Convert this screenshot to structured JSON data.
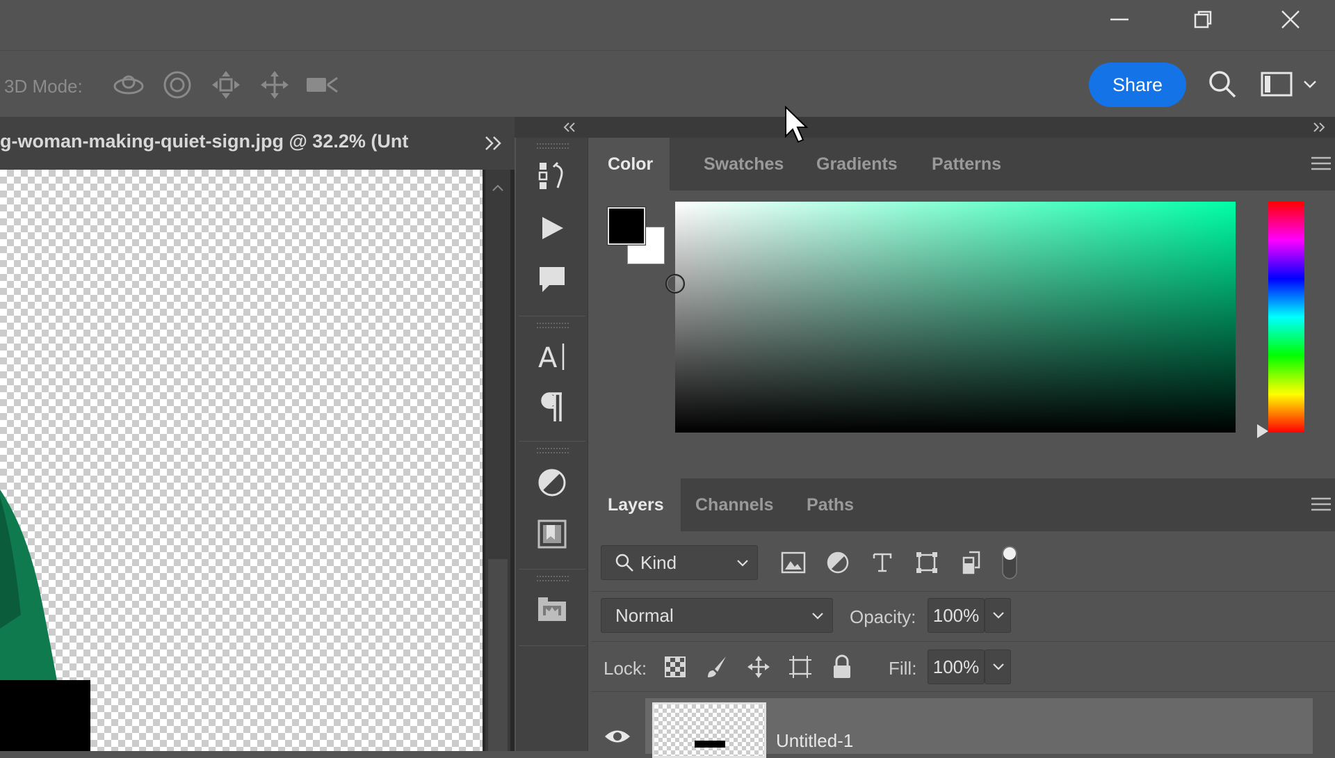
{
  "window": {
    "controls": [
      "minimize-icon",
      "restore-icon",
      "close-icon"
    ]
  },
  "options_bar": {
    "mode_label": "3D Mode:",
    "tools": [
      "orbit-3d-icon",
      "roll-3d-icon",
      "drag-3d-icon",
      "slide-3d-icon",
      "camera-zoom-icon"
    ],
    "share_label": "Share",
    "right_icons": [
      "search-icon",
      "workspace-icon",
      "chevron-down-icon"
    ]
  },
  "document": {
    "tab_title": "g-woman-making-quiet-sign.jpg @ 32.2% (Unt"
  },
  "icon_strip": [
    "history-icon",
    "actions-play-icon",
    "comments-icon",
    "character-icon",
    "paragraph-icon",
    "adjustments-icon",
    "libraries-icon",
    "properties-folder-icon"
  ],
  "color_panel": {
    "tabs": [
      {
        "label": "Color",
        "active": true
      },
      {
        "label": "Swatches",
        "active": false
      },
      {
        "label": "Gradients",
        "active": false
      },
      {
        "label": "Patterns",
        "active": false
      }
    ],
    "foreground": "#000000",
    "background": "#ffffff",
    "hue_color": "#00ffa6"
  },
  "layers_panel": {
    "tabs": [
      {
        "label": "Layers",
        "active": true
      },
      {
        "label": "Channels",
        "active": false
      },
      {
        "label": "Paths",
        "active": false
      }
    ],
    "filter_kind": "Kind",
    "filter_icons": [
      "image-filter-icon",
      "adjustment-filter-icon",
      "type-filter-icon",
      "shape-filter-icon",
      "smartobject-filter-icon",
      "filter-toggle-icon"
    ],
    "blend_mode": "Normal",
    "opacity_label": "Opacity:",
    "opacity_value": "100%",
    "lock_label": "Lock:",
    "lock_icons": [
      "lock-transparent-icon",
      "lock-brush-icon",
      "lock-move-icon",
      "lock-artboard-icon",
      "lock-all-icon"
    ],
    "fill_label": "Fill:",
    "fill_value": "100%",
    "layers": [
      {
        "name": "Untitled-1",
        "visible": true
      }
    ]
  },
  "colors": {
    "accent": "#1473e6",
    "panel_bg": "#535353",
    "tab_bg": "#424242",
    "canvas_subject": "#0f7a4e"
  }
}
